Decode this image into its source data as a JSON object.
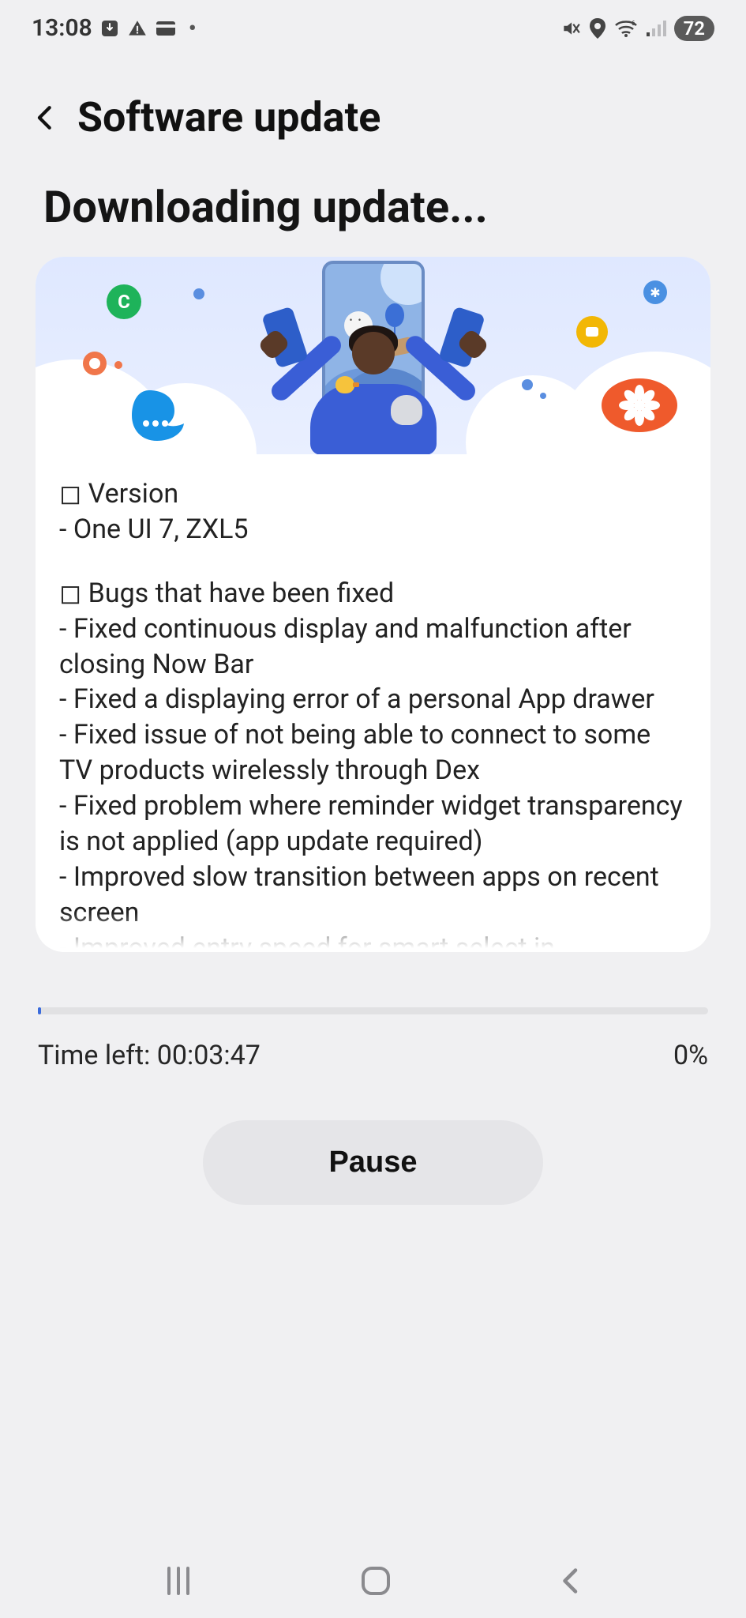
{
  "status_bar": {
    "time": "13:08",
    "battery": "72",
    "icons": {
      "download": "download-icon",
      "warning": "warning-icon",
      "card": "card-icon",
      "dot": "•",
      "mute": "mute-icon",
      "location": "location-icon",
      "wifi": "wifi-icon",
      "signal": "signal-icon"
    }
  },
  "header": {
    "back": "back",
    "title": "Software update"
  },
  "subtitle": "Downloading update...",
  "changelog": {
    "version_heading": "Version",
    "version_value": "One UI 7, ZXL5",
    "bugs_heading": "Bugs that have been fixed",
    "bug_items": [
      "Fixed continuous display and malfunction after closing Now Bar",
      "Fixed a displaying error of a personal App drawer",
      "Fixed issue of not being able to connect to some TV products wirelessly through Dex",
      "Fixed problem where reminder widget transparency is not applied (app update required)",
      "Improved slow transition between apps on recent screen",
      "Improved entry speed for smart select in"
    ]
  },
  "progress": {
    "time_left_label": "Time left: ",
    "time_left_value": "00:03:47",
    "percent": "0%",
    "percent_value": 0
  },
  "buttons": {
    "pause": "Pause"
  },
  "nav": {
    "recents": "recents",
    "home": "home",
    "back": "back"
  }
}
